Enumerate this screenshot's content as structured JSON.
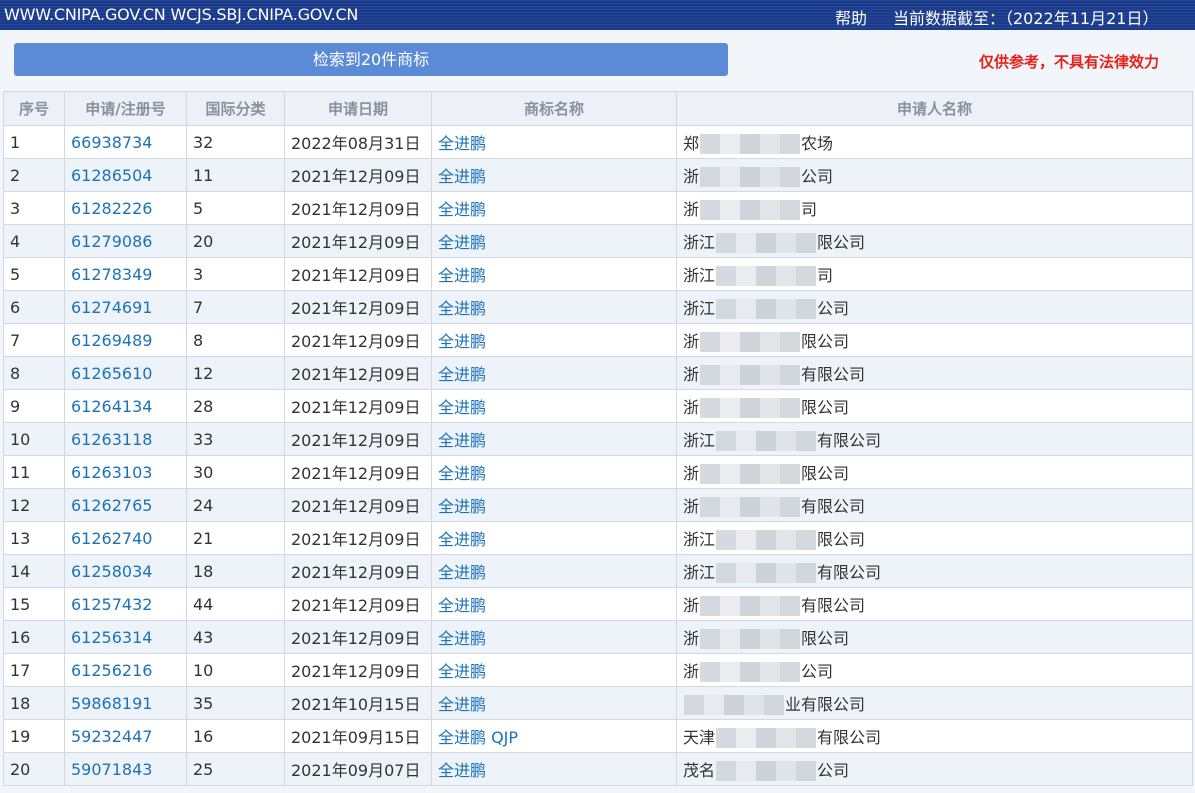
{
  "header": {
    "sites": "WWW.CNIPA.GOV.CN WCJS.SBJ.CNIPA.GOV.CN",
    "help": "帮助",
    "as_of": "当前数据截至：（2022年11月21日）"
  },
  "result_count": "检索到20件商标",
  "disclaimer": "仅供参考，不具有法律效力",
  "table": {
    "headers": [
      "序号",
      "申请/注册号",
      "国际分类",
      "申请日期",
      "商标名称",
      "申请人名称"
    ],
    "rows": [
      {
        "no": "1",
        "reg": "66938734",
        "cls": "32",
        "date": "2022年08月31日",
        "mark": "全进鹏",
        "app_pre": "郑",
        "app_suf": "农场"
      },
      {
        "no": "2",
        "reg": "61286504",
        "cls": "11",
        "date": "2021年12月09日",
        "mark": "全进鹏",
        "app_pre": "浙",
        "app_suf": "公司"
      },
      {
        "no": "3",
        "reg": "61282226",
        "cls": "5",
        "date": "2021年12月09日",
        "mark": "全进鹏",
        "app_pre": "浙",
        "app_suf": "司"
      },
      {
        "no": "4",
        "reg": "61279086",
        "cls": "20",
        "date": "2021年12月09日",
        "mark": "全进鹏",
        "app_pre": "浙江",
        "app_suf": "限公司"
      },
      {
        "no": "5",
        "reg": "61278349",
        "cls": "3",
        "date": "2021年12月09日",
        "mark": "全进鹏",
        "app_pre": "浙江",
        "app_suf": "司"
      },
      {
        "no": "6",
        "reg": "61274691",
        "cls": "7",
        "date": "2021年12月09日",
        "mark": "全进鹏",
        "app_pre": "浙江",
        "app_suf": "公司"
      },
      {
        "no": "7",
        "reg": "61269489",
        "cls": "8",
        "date": "2021年12月09日",
        "mark": "全进鹏",
        "app_pre": "浙",
        "app_suf": "限公司"
      },
      {
        "no": "8",
        "reg": "61265610",
        "cls": "12",
        "date": "2021年12月09日",
        "mark": "全进鹏",
        "app_pre": "浙",
        "app_suf": "有限公司"
      },
      {
        "no": "9",
        "reg": "61264134",
        "cls": "28",
        "date": "2021年12月09日",
        "mark": "全进鹏",
        "app_pre": "浙",
        "app_suf": "限公司"
      },
      {
        "no": "10",
        "reg": "61263118",
        "cls": "33",
        "date": "2021年12月09日",
        "mark": "全进鹏",
        "app_pre": "浙江",
        "app_suf": "有限公司"
      },
      {
        "no": "11",
        "reg": "61263103",
        "cls": "30",
        "date": "2021年12月09日",
        "mark": "全进鹏",
        "app_pre": "浙",
        "app_suf": "限公司"
      },
      {
        "no": "12",
        "reg": "61262765",
        "cls": "24",
        "date": "2021年12月09日",
        "mark": "全进鹏",
        "app_pre": "浙",
        "app_suf": "有限公司"
      },
      {
        "no": "13",
        "reg": "61262740",
        "cls": "21",
        "date": "2021年12月09日",
        "mark": "全进鹏",
        "app_pre": "浙江",
        "app_suf": "限公司"
      },
      {
        "no": "14",
        "reg": "61258034",
        "cls": "18",
        "date": "2021年12月09日",
        "mark": "全进鹏",
        "app_pre": "浙江",
        "app_suf": "有限公司"
      },
      {
        "no": "15",
        "reg": "61257432",
        "cls": "44",
        "date": "2021年12月09日",
        "mark": "全进鹏",
        "app_pre": "浙",
        "app_suf": "有限公司"
      },
      {
        "no": "16",
        "reg": "61256314",
        "cls": "43",
        "date": "2021年12月09日",
        "mark": "全进鹏",
        "app_pre": "浙",
        "app_suf": "限公司"
      },
      {
        "no": "17",
        "reg": "61256216",
        "cls": "10",
        "date": "2021年12月09日",
        "mark": "全进鹏",
        "app_pre": "浙",
        "app_suf": "公司"
      },
      {
        "no": "18",
        "reg": "59868191",
        "cls": "35",
        "date": "2021年10月15日",
        "mark": "全进鹏",
        "app_pre": "",
        "app_suf": "业有限公司"
      },
      {
        "no": "19",
        "reg": "59232447",
        "cls": "16",
        "date": "2021年09月15日",
        "mark": "全进鹏 QJP",
        "app_pre": "天津",
        "app_suf": "有限公司"
      },
      {
        "no": "20",
        "reg": "59071843",
        "cls": "25",
        "date": "2021年09月07日",
        "mark": "全进鹏",
        "app_pre": "茂名",
        "app_suf": "公司"
      }
    ]
  },
  "colors": {
    "header_bg": "#1a3a8c",
    "count_button": "#5b8ad6",
    "disclaimer": "#e8201a",
    "link": "#1c72b8"
  }
}
